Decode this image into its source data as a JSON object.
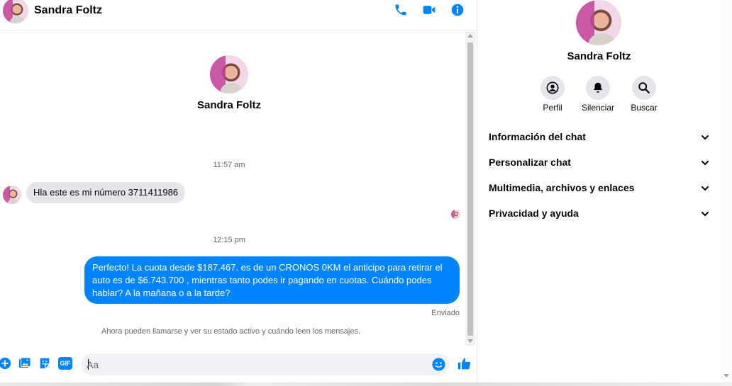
{
  "contact": {
    "name": "Sandra Foltz"
  },
  "header": {
    "call_icon": "phone-icon",
    "video_icon": "video-icon",
    "info_icon": "info-icon"
  },
  "conversation": {
    "intro_name": "Sandra Foltz",
    "time_1": "11:57 am",
    "incoming_message": "Hla este es mi número  3711411986",
    "time_2": "12:15 pm",
    "outgoing_message": "Perfecto! La cuota desde $187.467. es de un CRONOS 0KM el anticipo para retirar el auto es de $6.743.700 , mientras tanto podes ir pagando en cuotas. Cuándo podes hablar? A la mañana o a la tarde?",
    "status": "Enviado",
    "notice": "Ahora pueden llamarse y ver su estado activo y cuándo leen los mensajes."
  },
  "composer": {
    "placeholder": "Aa",
    "icons": [
      "plus-icon",
      "image-icon",
      "sticker-icon",
      "gif-icon",
      "emoji-icon",
      "like-icon"
    ],
    "gif_label": "GIF"
  },
  "info_panel": {
    "name": "Sandra Foltz",
    "actions": [
      {
        "label": "Perfil",
        "icon": "profile-icon"
      },
      {
        "label": "Silenciar",
        "icon": "bell-icon"
      },
      {
        "label": "Buscar",
        "icon": "search-icon"
      }
    ],
    "sections": [
      {
        "label": "Información del chat"
      },
      {
        "label": "Personalizar chat"
      },
      {
        "label": "Multimedia, archivos y enlaces"
      },
      {
        "label": "Privacidad y ayuda"
      }
    ]
  },
  "colors": {
    "accent": "#0084ff",
    "bubble_in": "#e4e6eb",
    "muted_text": "#65676b"
  }
}
